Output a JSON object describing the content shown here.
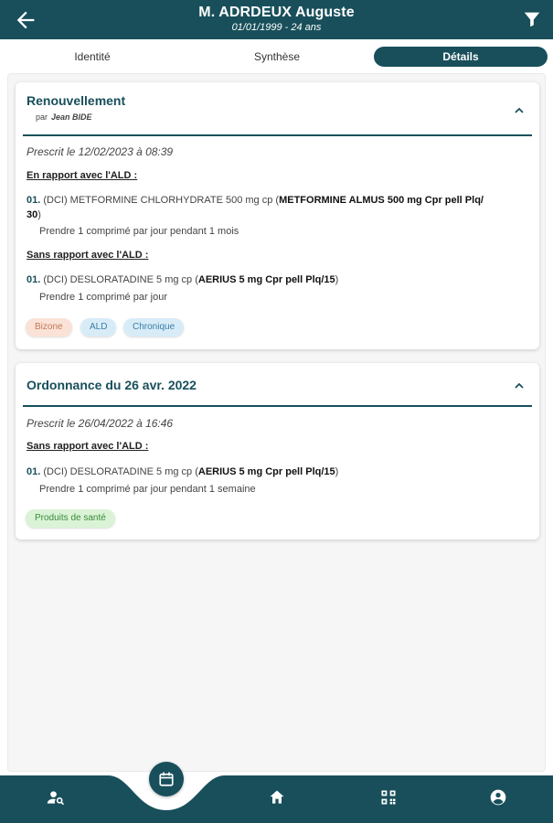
{
  "header": {
    "title": "M. ADRDEUX Auguste",
    "subtitle": "01/01/1999 - 24 ans"
  },
  "tabs": [
    {
      "label": "Identité",
      "active": false
    },
    {
      "label": "Synthèse",
      "active": false
    },
    {
      "label": "Détails",
      "active": true
    }
  ],
  "cards": [
    {
      "title": "Renouvellement",
      "by_prefix": "par",
      "by_name": "Jean BIDE",
      "prescribed": "Prescrit le 12/02/2023 à 08:39",
      "sections": [
        {
          "title": "En rapport avec l'ALD :",
          "items": [
            {
              "num": "01.",
              "dci": "(DCI) METFORMINE CHLORHYDRATE 500 mg cp (",
              "brand": "METFORMINE ALMUS 500 mg Cpr pell Plq/",
              "tail": "30",
              "close": ")",
              "posology": "Prendre 1 comprimé par jour pendant 1 mois"
            }
          ]
        },
        {
          "title": "Sans rapport avec l'ALD :",
          "items": [
            {
              "num": "01.",
              "dci": "(DCI) DESLORATADINE 5 mg cp (",
              "brand": "AERIUS 5 mg Cpr pell Plq/15",
              "close": ")",
              "posology": "Prendre 1 comprimé par jour"
            }
          ]
        }
      ],
      "tags": [
        "Bizone",
        "ALD",
        "Chronique"
      ]
    },
    {
      "title": "Ordonnance du 26 avr. 2022",
      "prescribed": "Prescrit le 26/04/2022 à 16:46",
      "sections": [
        {
          "title": "Sans rapport avec l'ALD :",
          "items": [
            {
              "num": "01.",
              "dci": "(DCI) DESLORATADINE 5 mg cp (",
              "brand": "AERIUS 5 mg Cpr pell Plq/15",
              "close": ")",
              "posology": "Prendre 1 comprimé par jour pendant 1 semaine"
            }
          ]
        }
      ],
      "tags": [
        "Produits de santé"
      ]
    }
  ],
  "bottom_nav": [
    "patient-search-icon",
    "calendar-icon",
    "home-icon",
    "qr-code-icon",
    "account-icon"
  ],
  "colors": {
    "primary": "#184f5b",
    "tag_bizone_bg": "#fbe2d6",
    "tag_ald_bg": "#d8ecf8",
    "tag_produits_bg": "#daf3d6"
  }
}
